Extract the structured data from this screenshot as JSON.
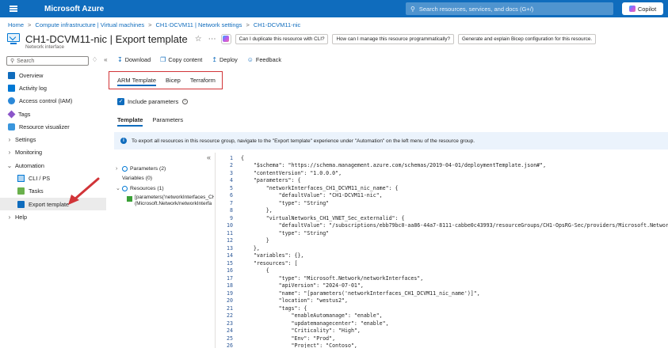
{
  "topbar": {
    "brand": "Microsoft Azure",
    "search_placeholder": "Search resources, services, and docs (G+/)",
    "copilot_label": "Copilot"
  },
  "breadcrumb": [
    "Home",
    "Compute infrastructure | Virtual machines",
    "CH1-DCVM11 | Network settings",
    "CH1-DCVM11-nic"
  ],
  "header": {
    "title": "CH1-DCVM11-nic | Export template",
    "subtitle": "Network interface",
    "suggestions": [
      "Can I duplicate this resource with CLI?",
      "How can I manage this resource programmatically?",
      "Generate and explain Bicep configuration for this resource."
    ]
  },
  "sidebar": {
    "search_placeholder": "Search",
    "items": [
      {
        "label": "Overview",
        "icon": "overview-icon",
        "indent": 0,
        "chevron": ""
      },
      {
        "label": "Activity log",
        "icon": "activity-log-icon",
        "indent": 0,
        "chevron": ""
      },
      {
        "label": "Access control (IAM)",
        "icon": "iam-icon",
        "indent": 0,
        "chevron": ""
      },
      {
        "label": "Tags",
        "icon": "tag-icon",
        "indent": 0,
        "chevron": ""
      },
      {
        "label": "Resource visualizer",
        "icon": "visualizer-icon",
        "indent": 0,
        "chevron": ""
      },
      {
        "label": "Settings",
        "icon": "",
        "indent": 0,
        "chevron": ">"
      },
      {
        "label": "Monitoring",
        "icon": "",
        "indent": 0,
        "chevron": ">"
      },
      {
        "label": "Automation",
        "icon": "",
        "indent": 0,
        "chevron": "v"
      },
      {
        "label": "CLI / PS",
        "icon": "cli-icon",
        "indent": 1,
        "chevron": ""
      },
      {
        "label": "Tasks",
        "icon": "tasks-icon",
        "indent": 1,
        "chevron": ""
      },
      {
        "label": "Export template",
        "icon": "export-template-icon",
        "indent": 1,
        "chevron": "",
        "selected": true
      },
      {
        "label": "Help",
        "icon": "",
        "indent": 0,
        "chevron": ">"
      }
    ]
  },
  "toolbar": {
    "download": "Download",
    "copy": "Copy content",
    "deploy": "Deploy",
    "feedback": "Feedback"
  },
  "format_tabs": [
    "ARM Template",
    "Bicep",
    "Terraform"
  ],
  "include_parameters": "Include parameters",
  "template_tabs": [
    "Template",
    "Parameters"
  ],
  "info_message": "To export all resources in this resource group, navigate to the \"Export template\" experience under \"Automation\" on the left menu of the resource group.",
  "tree": {
    "parameters": "Parameters (2)",
    "variables": "Variables (0)",
    "resources": "Resources (1)",
    "resource_line1": "[parameters('networkInterfaces_CH",
    "resource_line2": "(Microsoft.Network/networkInterfa"
  },
  "code_lines": [
    {
      "n": "1",
      "t": "{"
    },
    {
      "n": "2",
      "t": "    \"$schema\": \"https://schema.management.azure.com/schemas/2019-04-01/deploymentTemplate.json#\","
    },
    {
      "n": "3",
      "t": "    \"contentVersion\": \"1.0.0.0\","
    },
    {
      "n": "4",
      "t": "    \"parameters\": {"
    },
    {
      "n": "5",
      "t": "        \"networkInterfaces_CH1_DCVM11_nic_name\": {"
    },
    {
      "n": "6",
      "t": "            \"defaultValue\": \"CH1-DCVM11-nic\","
    },
    {
      "n": "7",
      "t": "            \"type\": \"String\""
    },
    {
      "n": "8",
      "t": "        },"
    },
    {
      "n": "9",
      "t": "        \"virtualNetworks_CH1_VNET_Sec_externalid\": {"
    },
    {
      "n": "10",
      "t": "            \"defaultValue\": \"/subscriptions/ebb79bc0-aa86-44a7-8111-cabbe0c43993/resourceGroups/CH1-OpsRG-Sec/providers/Microsoft.Network/vi"
    },
    {
      "n": "11",
      "t": "            \"type\": \"String\""
    },
    {
      "n": "12",
      "t": "        }"
    },
    {
      "n": "13",
      "t": "    },"
    },
    {
      "n": "14",
      "t": "    \"variables\": {},"
    },
    {
      "n": "15",
      "t": "    \"resources\": ["
    },
    {
      "n": "16",
      "t": "        {"
    },
    {
      "n": "17",
      "t": "            \"type\": \"Microsoft.Network/networkInterfaces\","
    },
    {
      "n": "18",
      "t": "            \"apiVersion\": \"2024-07-01\","
    },
    {
      "n": "19",
      "t": "            \"name\": \"[parameters('networkInterfaces_CH1_DCVM11_nic_name')]\","
    },
    {
      "n": "20",
      "t": "            \"location\": \"westus2\","
    },
    {
      "n": "21",
      "t": "            \"tags\": {"
    },
    {
      "n": "22",
      "t": "                \"enableAutomanage\": \"enable\","
    },
    {
      "n": "23",
      "t": "                \"updatemanagecenter\": \"enable\","
    },
    {
      "n": "24",
      "t": "                \"Criticality\": \"High\","
    },
    {
      "n": "25",
      "t": "                \"Env\": \"Prod\","
    },
    {
      "n": "26",
      "t": "                \"Project\": \"Contoso\","
    }
  ]
}
